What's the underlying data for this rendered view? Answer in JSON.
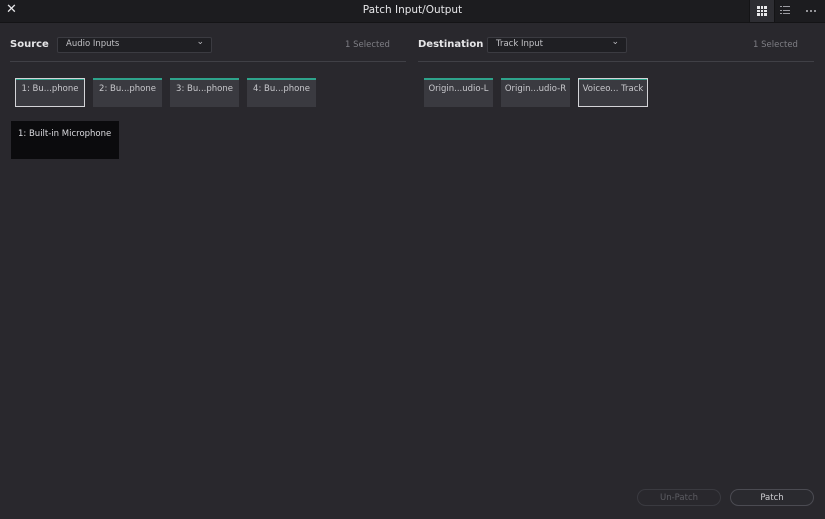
{
  "window": {
    "title": "Patch Input/Output",
    "close_glyph": "✕",
    "view_buttons": [
      "grid-view-icon",
      "list-view-icon",
      "more-options-icon"
    ]
  },
  "source": {
    "label": "Source",
    "dropdown_value": "Audio Inputs",
    "selected_count": "1 Selected",
    "chips": [
      "1: Bu...phone",
      "2: Bu...phone",
      "3: Bu...phone",
      "4: Bu...phone"
    ],
    "selected_index": 0,
    "device_name": "1: Built-in Microphone"
  },
  "destination": {
    "label": "Destination",
    "dropdown_value": "Track Input",
    "selected_count": "1 Selected",
    "chips": [
      "Origin...udio-L",
      "Origin...udio-R",
      "Voiceo... Track"
    ],
    "selected_index": 2
  },
  "buttons": {
    "unpatch": "Un-Patch",
    "patch": "Patch"
  },
  "colors": {
    "accent_green": "#2ea38b",
    "background": "#29282d",
    "titlebar": "#1c1c1f"
  }
}
